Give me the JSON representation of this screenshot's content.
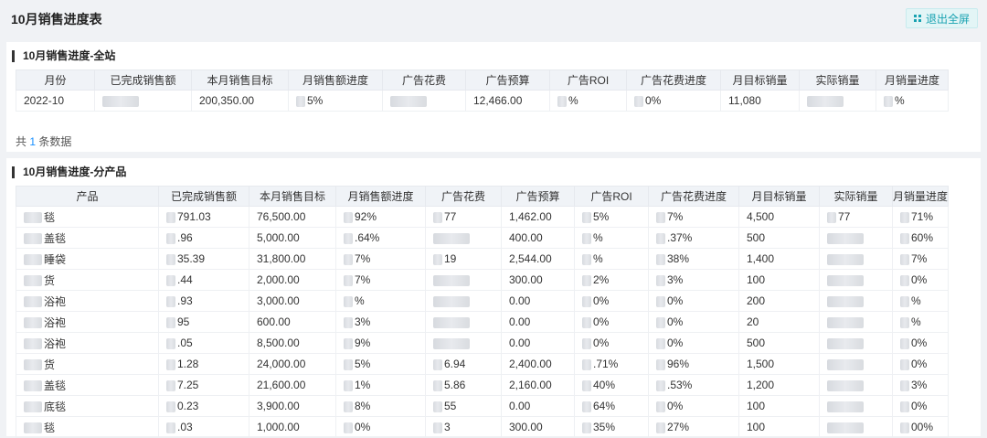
{
  "page": {
    "title": "10月销售进度表",
    "exit_fullscreen": "退出全屏",
    "fullscreen_icon": "grid-icon"
  },
  "site": {
    "title": "10月销售进度-全站",
    "columns": [
      "月份",
      "已完成销售额",
      "本月销售目标",
      "月销售额进度",
      "广告花费",
      "广告预算",
      "广告ROI",
      "广告花费进度",
      "月目标销量",
      "实际销量",
      "月销量进度"
    ],
    "row": [
      "2022-10",
      "",
      "200,350.00",
      "5%",
      "",
      "12,466.00",
      "%",
      "0%",
      "11,080",
      "",
      "%"
    ],
    "count_prefix": "共",
    "count": "1",
    "count_suffix": "条数据"
  },
  "product": {
    "title": "10月销售进度-分产品",
    "columns": [
      "产品",
      "已完成销售额",
      "本月销售目标",
      "月销售额进度",
      "广告花费",
      "广告预算",
      "广告ROI",
      "广告花费进度",
      "月目标销量",
      "实际销量",
      "月销量进度"
    ],
    "rows": [
      [
        "毯",
        "791.03",
        "76,500.00",
        "92%",
        "77",
        "1,462.00",
        "5%",
        "7%",
        "4,500",
        "77",
        "71%"
      ],
      [
        "盖毯",
        ".96",
        "5,000.00",
        ".64%",
        "",
        "400.00",
        "%",
        ".37%",
        "500",
        "",
        "60%"
      ],
      [
        "睡袋",
        "35.39",
        "31,800.00",
        "7%",
        "19",
        "2,544.00",
        "%",
        "38%",
        "1,400",
        "",
        "7%"
      ],
      [
        "货",
        ".44",
        "2,000.00",
        "7%",
        "",
        "300.00",
        "2%",
        "3%",
        "100",
        "",
        "0%"
      ],
      [
        "浴袍",
        ".93",
        "3,000.00",
        "%",
        "",
        "0.00",
        "0%",
        "0%",
        "200",
        "",
        "%"
      ],
      [
        "浴袍",
        "95",
        "600.00",
        "3%",
        "",
        "0.00",
        "0%",
        "0%",
        "20",
        "",
        "%"
      ],
      [
        "浴袍",
        ".05",
        "8,500.00",
        "9%",
        "",
        "0.00",
        "0%",
        "0%",
        "500",
        "",
        "0%"
      ],
      [
        "货",
        "1.28",
        "24,000.00",
        "5%",
        "6.94",
        "2,400.00",
        ".71%",
        "96%",
        "1,500",
        "",
        "0%"
      ],
      [
        "盖毯",
        "7.25",
        "21,600.00",
        "1%",
        "5.86",
        "2,160.00",
        "40%",
        ".53%",
        "1,200",
        "",
        "3%"
      ],
      [
        "底毯",
        "0.23",
        "3,900.00",
        "8%",
        "55",
        "0.00",
        "64%",
        "0%",
        "100",
        "",
        "0%"
      ],
      [
        "毯",
        ".03",
        "1,000.00",
        "0%",
        "3",
        "300.00",
        "35%",
        "27%",
        "100",
        "",
        "00%"
      ]
    ]
  }
}
